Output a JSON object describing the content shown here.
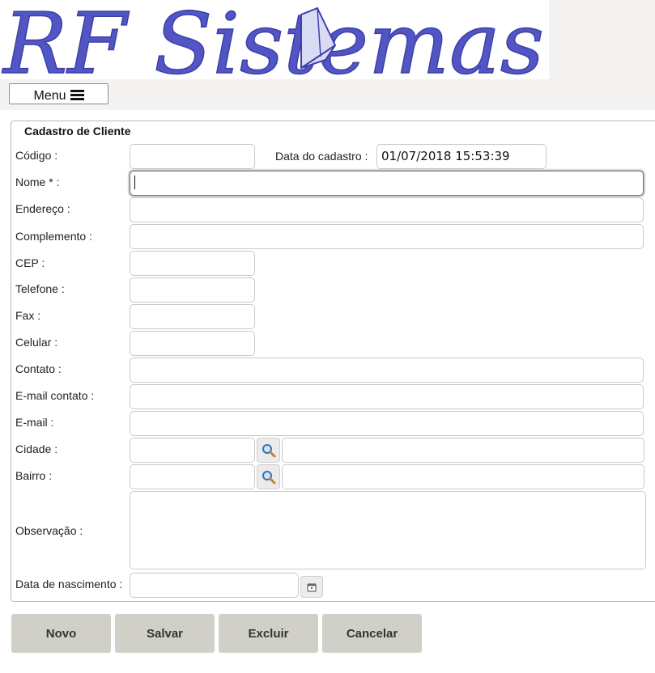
{
  "header": {
    "logo_text": "RF Sistemas",
    "menu_label": "Menu",
    "menu_icon": "hamburger-icon"
  },
  "form": {
    "legend": "Cadastro de Cliente",
    "codigo": {
      "label": "Código :",
      "value": ""
    },
    "data_cadastro": {
      "label": "Data do cadastro :",
      "value": "01/07/2018 15:53:39"
    },
    "nome": {
      "label": "Nome * :",
      "value": ""
    },
    "endereco": {
      "label": "Endereço :",
      "value": ""
    },
    "complemento": {
      "label": "Complemento :",
      "value": ""
    },
    "cep": {
      "label": "CEP :",
      "value": ""
    },
    "telefone": {
      "label": "Telefone :",
      "value": ""
    },
    "fax": {
      "label": "Fax :",
      "value": ""
    },
    "celular": {
      "label": "Celular :",
      "value": ""
    },
    "contato": {
      "label": "Contato :",
      "value": ""
    },
    "email_contato": {
      "label": "E-mail contato :",
      "value": ""
    },
    "email": {
      "label": "E-mail :",
      "value": ""
    },
    "cidade": {
      "label": "Cidade :",
      "code": "",
      "name": "",
      "icon": "search-magnifier-icon"
    },
    "bairro": {
      "label": "Bairro :",
      "code": "",
      "name": "",
      "icon": "search-magnifier-icon"
    },
    "observacao": {
      "label": "Observação :",
      "value": ""
    },
    "data_nascimento": {
      "label": "Data de nascimento :",
      "value": "",
      "icon": "calendar-icon"
    }
  },
  "actions": {
    "novo": "Novo",
    "salvar": "Salvar",
    "excluir": "Excluir",
    "cancelar": "Cancelar"
  },
  "colors": {
    "logo": "#5256c4",
    "topbar": "#f4f3f1",
    "button_bg": "#d1d0c8"
  }
}
